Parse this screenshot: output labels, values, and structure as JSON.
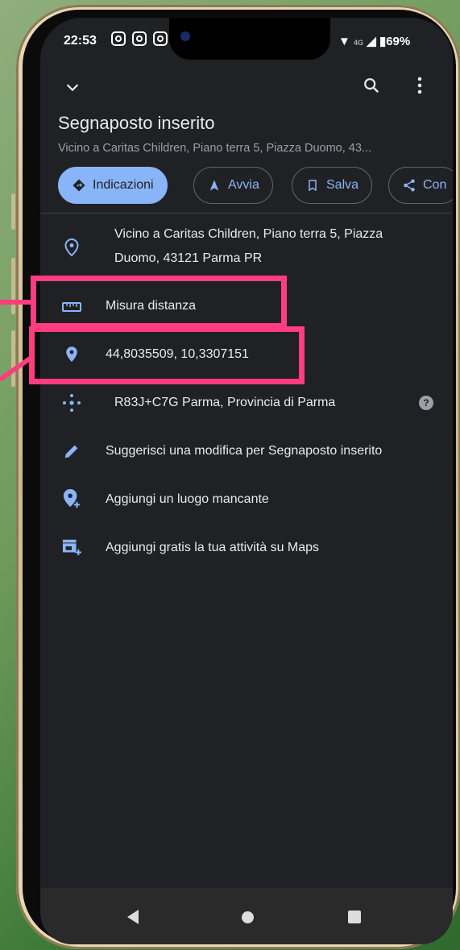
{
  "status_bar": {
    "time": "22:53",
    "network": "4G",
    "battery": "69%"
  },
  "header": {
    "title": "Segnaposto inserito",
    "subtitle": "Vicino a Caritas Children, Piano terra 5, Piazza Duomo, 43..."
  },
  "chips": [
    {
      "label": "Indicazioni",
      "icon": "directions-icon"
    },
    {
      "label": "Avvia",
      "icon": "navigation-arrow-icon"
    },
    {
      "label": "Salva",
      "icon": "bookmark-icon"
    },
    {
      "label": "Con",
      "icon": "share-icon"
    }
  ],
  "rows": {
    "address": {
      "line1": "Vicino a Caritas Children, Piano terra 5, Piazza",
      "line2": "Duomo, 43121 Parma PR",
      "icon": "location-outline-icon"
    },
    "measure": {
      "label": "Misura distanza",
      "icon": "ruler-icon"
    },
    "coordinates": {
      "label": "44,8035509, 10,3307151",
      "icon": "location-pin-icon"
    },
    "plus_code": {
      "label": "R83J+C7G Parma, Provincia di Parma",
      "icon": "plus-code-icon",
      "help": "?"
    },
    "suggest": {
      "label": "Suggerisci una modifica per Segnaposto inserito",
      "icon": "pencil-icon"
    },
    "add_place": {
      "label": "Aggiungi un luogo mancante",
      "icon": "add-location-icon"
    },
    "add_business": {
      "label": "Aggiungi gratis la tua attività su Maps",
      "icon": "add-business-icon"
    }
  },
  "colors": {
    "accent": "#8ab4f8",
    "highlight": "#ff3d7f",
    "background": "#202124"
  }
}
